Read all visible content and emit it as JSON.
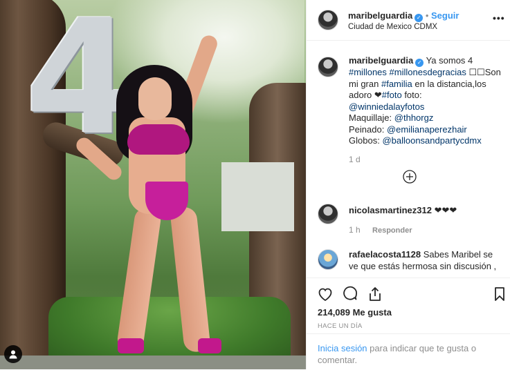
{
  "post": {
    "username": "maribelguardia",
    "follow_label": "Seguir",
    "location": "Ciudad de Mexico CDMX",
    "more_icon": "more-horizontal-icon"
  },
  "photo": {
    "balloon_text": "4"
  },
  "caption": {
    "username": "maribelguardia",
    "text_1": "Ya somos 4",
    "tag_millones": "#millones",
    "tag_millonesdegracias": "#millonesdegracias",
    "text_2": "☐☐Son mi gran",
    "tag_familia": "#familia",
    "text_3": "en la distancia,los adoro ❤",
    "tag_foto": "#foto",
    "text_4": "foto:",
    "mention_foto": "@winniedalayfotos",
    "maquillaje_label": "Maquillaje:",
    "mention_maquillaje": "@thhorgz",
    "peinado_label": "Peinado:",
    "mention_peinado": "@emilianaperezhair",
    "globos_label": "Globos:",
    "mention_globos": "@balloonsandpartycdmx",
    "time": "1 d"
  },
  "comments": [
    {
      "username": "nicolasmartinez312",
      "text": "❤❤❤",
      "time": "1 h",
      "reply_label": "Responder"
    },
    {
      "username": "rafaelacosta1128",
      "text": "Sabes Maribel se ve que estás hermosa sin discusión ,"
    }
  ],
  "stats": {
    "likes": "214,089 Me gusta",
    "posted": "HACE UN DÍA"
  },
  "login": {
    "link": "Inicia sesión",
    "text": "para indicar que te gusta o comentar."
  }
}
